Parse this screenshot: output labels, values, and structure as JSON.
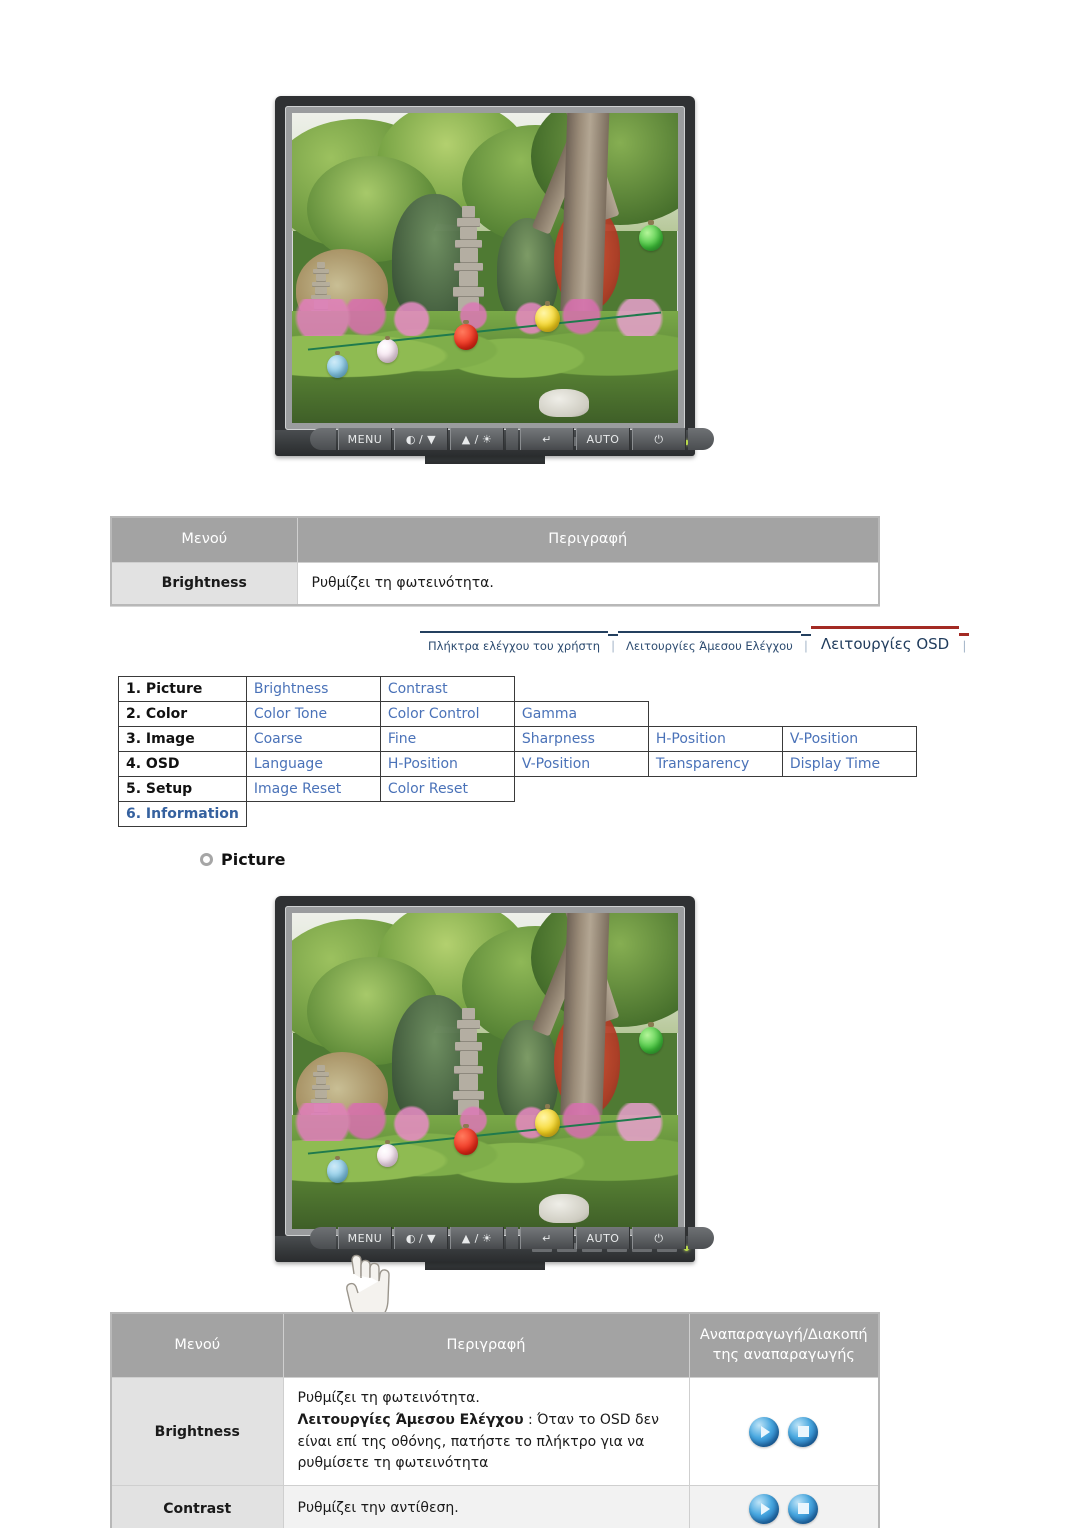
{
  "monitor_top": {
    "alt": "LCD monitor displaying a garden photo with a stone pagoda and paper lanterns",
    "controls": [
      {
        "name": "menu-button",
        "label": "MENU"
      },
      {
        "name": "contrast-down-button",
        "label": "/ ▼",
        "icon": "contrast-icon"
      },
      {
        "name": "brightness-up-button",
        "label": "▲ /",
        "icon": "sun-icon"
      },
      {
        "name": "enter-button",
        "label": "",
        "icon": "enter-icon"
      },
      {
        "name": "auto-button",
        "label": "AUTO"
      },
      {
        "name": "power-button",
        "label": "",
        "icon": "power-icon"
      }
    ]
  },
  "table_top": {
    "headers": [
      "Μενού",
      "Περιγραφή"
    ],
    "rows": [
      {
        "menu": "Brightness",
        "description": "Ρυθμίζει τη φωτεινότητα."
      }
    ]
  },
  "nav": {
    "items": [
      {
        "label": "Πλήκτρα ελέγχου του χρήστη",
        "active": false
      },
      {
        "label": "Λειτουργίες Άμεσου Ελέγχου",
        "active": false
      },
      {
        "label": "Λειτουργίες OSD",
        "active": true
      }
    ],
    "separator": "│"
  },
  "menu_grid": {
    "rows": [
      {
        "category": "1. Picture",
        "category_highlight": false,
        "items": [
          "Brightness",
          "Contrast"
        ]
      },
      {
        "category": "2. Color",
        "category_highlight": false,
        "items": [
          "Color Tone",
          "Color Control",
          "Gamma"
        ]
      },
      {
        "category": "3. Image",
        "category_highlight": false,
        "items": [
          "Coarse",
          "Fine",
          "Sharpness",
          "H-Position",
          "V-Position"
        ]
      },
      {
        "category": "4. OSD",
        "category_highlight": false,
        "items": [
          "Language",
          "H-Position",
          "V-Position",
          "Transparency",
          "Display Time"
        ]
      },
      {
        "category": "5. Setup",
        "category_highlight": false,
        "items": [
          "Image Reset",
          "Color Reset"
        ]
      },
      {
        "category": "6. Information",
        "category_highlight": true,
        "items": []
      }
    ]
  },
  "section_heading": {
    "bullet": "ring-bullet-icon",
    "title": "Picture"
  },
  "monitor_bottom": {
    "alt": "LCD monitor displaying the same garden photo, with a hand cursor pressing the MENU key",
    "cursor": "hand-cursor-icon"
  },
  "table_bottom": {
    "headers": [
      "Μενού",
      "Περιγραφή",
      "Αναπαραγωγή/Διακοπή της αναπαραγωγής"
    ],
    "rows": [
      {
        "menu": "Brightness",
        "desc_line1": "Ρυθμίζει τη φωτεινότητα.",
        "desc_bold": "Λειτουργίες Άμεσου Ελέγχου",
        "desc_rest": " : Όταν το OSD δεν είναι επί της οθόνης, πατήστε το πλήκτρο για να ρυθμίσετε τη φωτεινότητα",
        "icons": [
          "play-icon",
          "stop-icon"
        ]
      },
      {
        "menu": "Contrast",
        "desc_line1": "Ρυθμίζει την αντίθεση.",
        "desc_bold": "",
        "desc_rest": "",
        "icons": [
          "play-icon",
          "stop-icon"
        ]
      }
    ]
  },
  "colors": {
    "header_grey": "#a3a3a3",
    "label_grey": "#e2e2e2",
    "link_blue": "#4a72b8",
    "active_tab_red": "#a32a23",
    "nav_navy": "#24405f"
  }
}
